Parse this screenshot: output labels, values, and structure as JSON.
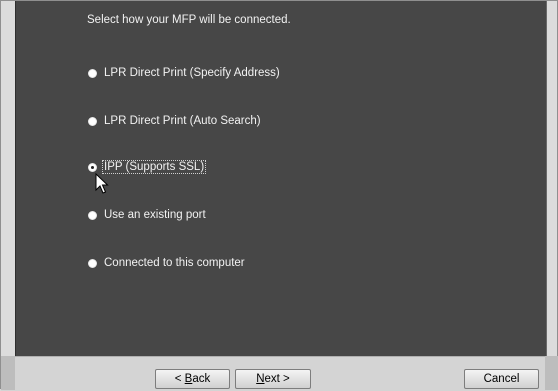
{
  "dialog": {
    "instruction": "Select how your MFP will be connected."
  },
  "options": [
    {
      "label": "LPR Direct Print (Specify Address)",
      "selected": false
    },
    {
      "label": "LPR Direct Print (Auto Search)",
      "selected": false
    },
    {
      "label": "IPP (Supports SSL)",
      "selected": true
    },
    {
      "label": "Use an existing port",
      "selected": false
    },
    {
      "label": "Connected to this computer",
      "selected": false
    }
  ],
  "buttons": {
    "back_prefix": "< ",
    "back_mnemonic": "B",
    "back_rest": "ack",
    "next_mnemonic": "N",
    "next_rest": "ext >",
    "cancel": "Cancel"
  }
}
